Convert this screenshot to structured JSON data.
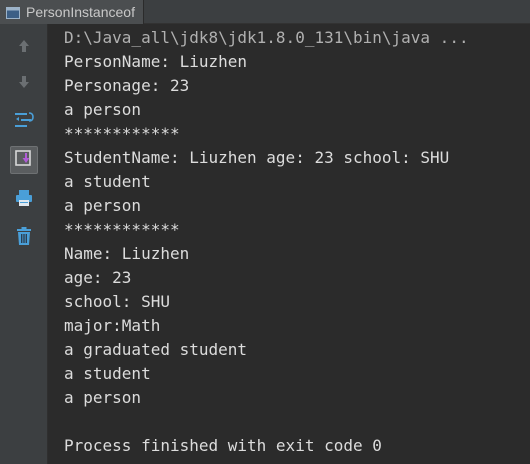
{
  "window": {
    "tab_title": "PersonInstanceof"
  },
  "toolbar": {
    "buttons": [
      {
        "name": "up-arrow",
        "icon": "arrow-up-icon"
      },
      {
        "name": "down-arrow",
        "icon": "arrow-down-icon"
      },
      {
        "name": "soft-wrap",
        "icon": "soft-wrap-icon"
      },
      {
        "name": "scroll-to-end",
        "icon": "scroll-to-end-icon"
      },
      {
        "name": "print",
        "icon": "printer-icon"
      },
      {
        "name": "clear-all",
        "icon": "trash-icon"
      }
    ]
  },
  "console": {
    "lines": [
      "D:\\Java_all\\jdk8\\jdk1.8.0_131\\bin\\java ...",
      "PersonName: Liuzhen",
      "Personage: 23",
      "a person",
      "************",
      "StudentName: Liuzhen age: 23 school: SHU",
      "a student",
      "a person",
      "************",
      "Name: Liuzhen",
      "age: 23",
      "school: SHU",
      "major:Math",
      "a graduated student",
      "a student",
      "a person",
      "",
      "Process finished with exit code 0"
    ]
  },
  "colors": {
    "background": "#2b2b2b",
    "gutter": "#3c3f41",
    "text": "#dcdcdc",
    "icon_blue": "#4a9fd8"
  }
}
